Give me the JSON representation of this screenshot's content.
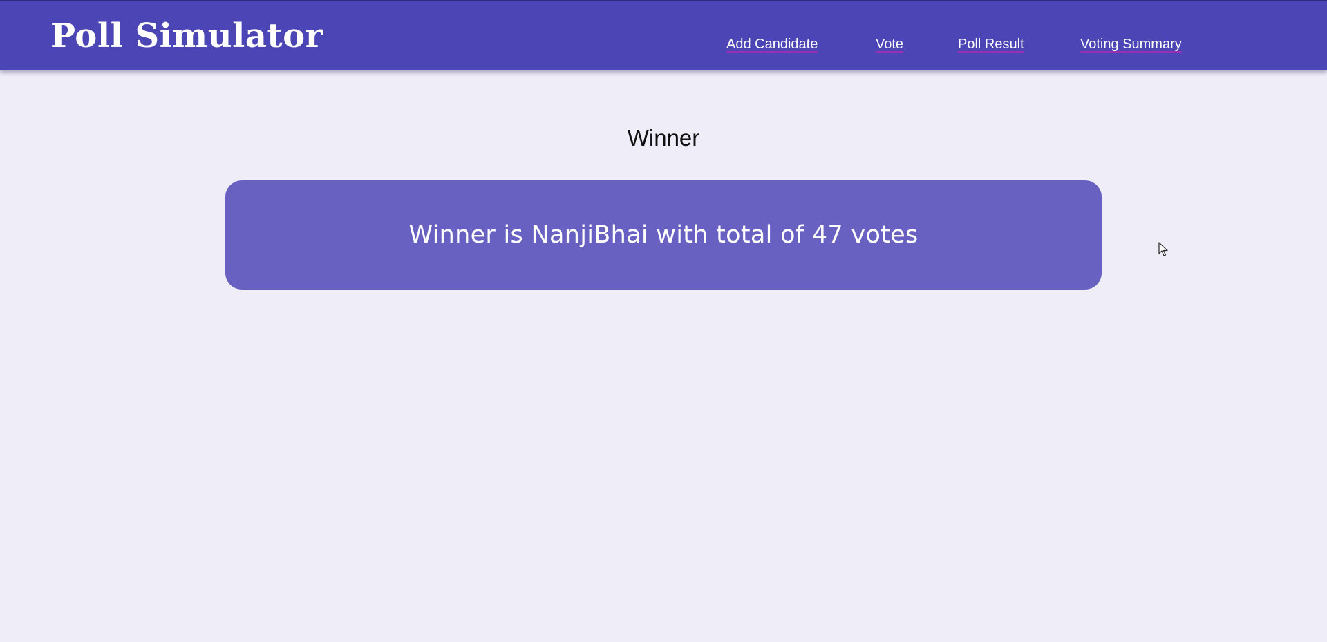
{
  "header": {
    "brand": "Poll Simulator",
    "nav": [
      {
        "label": "Add Candidate"
      },
      {
        "label": "Vote"
      },
      {
        "label": "Poll Result"
      },
      {
        "label": "Voting Summary"
      }
    ]
  },
  "main": {
    "heading": "Winner",
    "winner_message": "Winner is NanjiBhai with total of 47 votes"
  },
  "colors": {
    "navbar": "#4c45b5",
    "card": "#6861c2",
    "background": "#efedf7",
    "link_underline": "#9a2fb3"
  },
  "icons": {
    "cursor": "mouse-pointer-icon"
  }
}
